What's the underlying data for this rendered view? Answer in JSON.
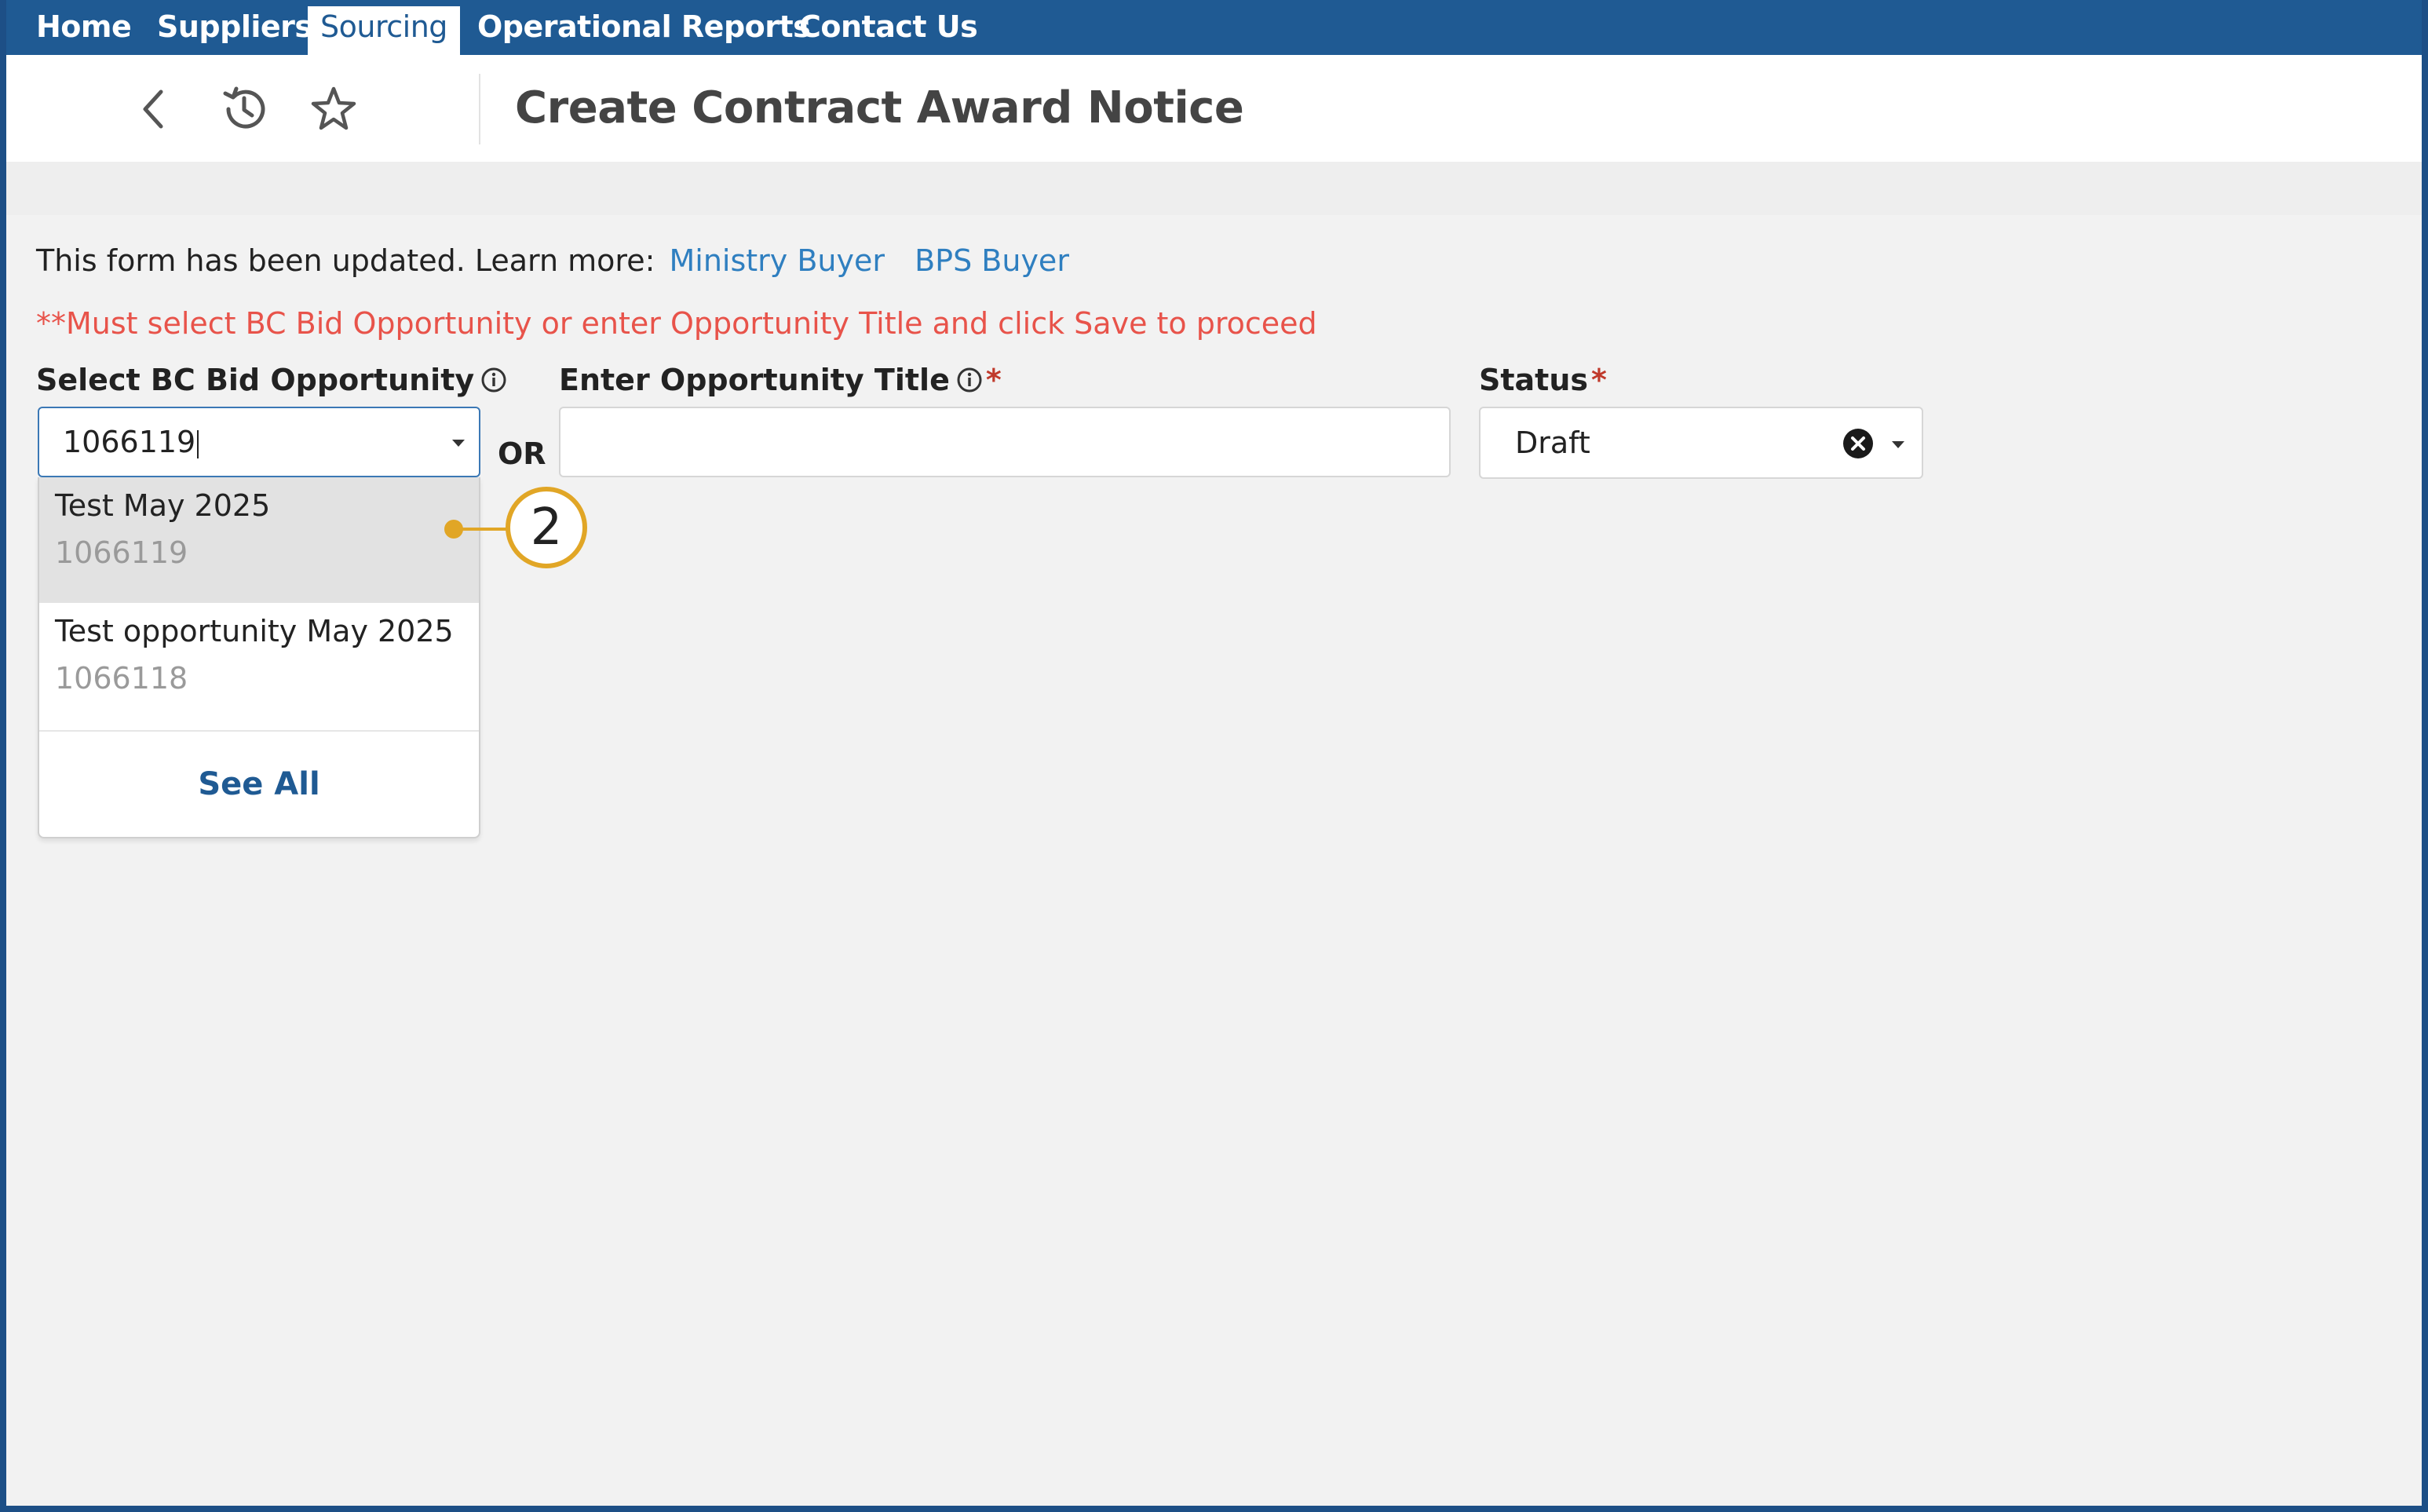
{
  "nav": {
    "items": [
      {
        "label": "Home",
        "active": false
      },
      {
        "label": "Suppliers",
        "active": false
      },
      {
        "label": "Sourcing",
        "active": true
      },
      {
        "label": "Operational Reports",
        "active": false
      },
      {
        "label": "Contact Us",
        "active": false
      }
    ]
  },
  "header": {
    "title": "Create Contract Award Notice",
    "icons": [
      "back-icon",
      "history-icon",
      "star-icon"
    ]
  },
  "form": {
    "info_text": "This form has been updated. Learn more:",
    "link_ministry": "Ministry Buyer",
    "link_bps": "BPS Buyer",
    "warning": "**Must select BC Bid Opportunity or enter Opportunity Title and click Save to proceed",
    "opportunity": {
      "label": "Select BC Bid Opportunity",
      "value": "1066119"
    },
    "or_text": "OR",
    "title_field": {
      "label": "Enter Opportunity Title",
      "required_mark": "*",
      "value": ""
    },
    "status": {
      "label": "Status",
      "required_mark": "*",
      "value": "Draft"
    }
  },
  "dropdown": {
    "options": [
      {
        "title": "Test May 2025",
        "number": "1066119",
        "highlighted": true
      },
      {
        "title": "Test opportunity May 2025",
        "number": "1066118",
        "highlighted": false
      }
    ],
    "see_all": "See All"
  },
  "callout": {
    "number": "2"
  },
  "colors": {
    "nav_bg": "#1f5a93",
    "link": "#2f7fc0",
    "warning": "#e8534a",
    "callout": "#e1a626"
  }
}
